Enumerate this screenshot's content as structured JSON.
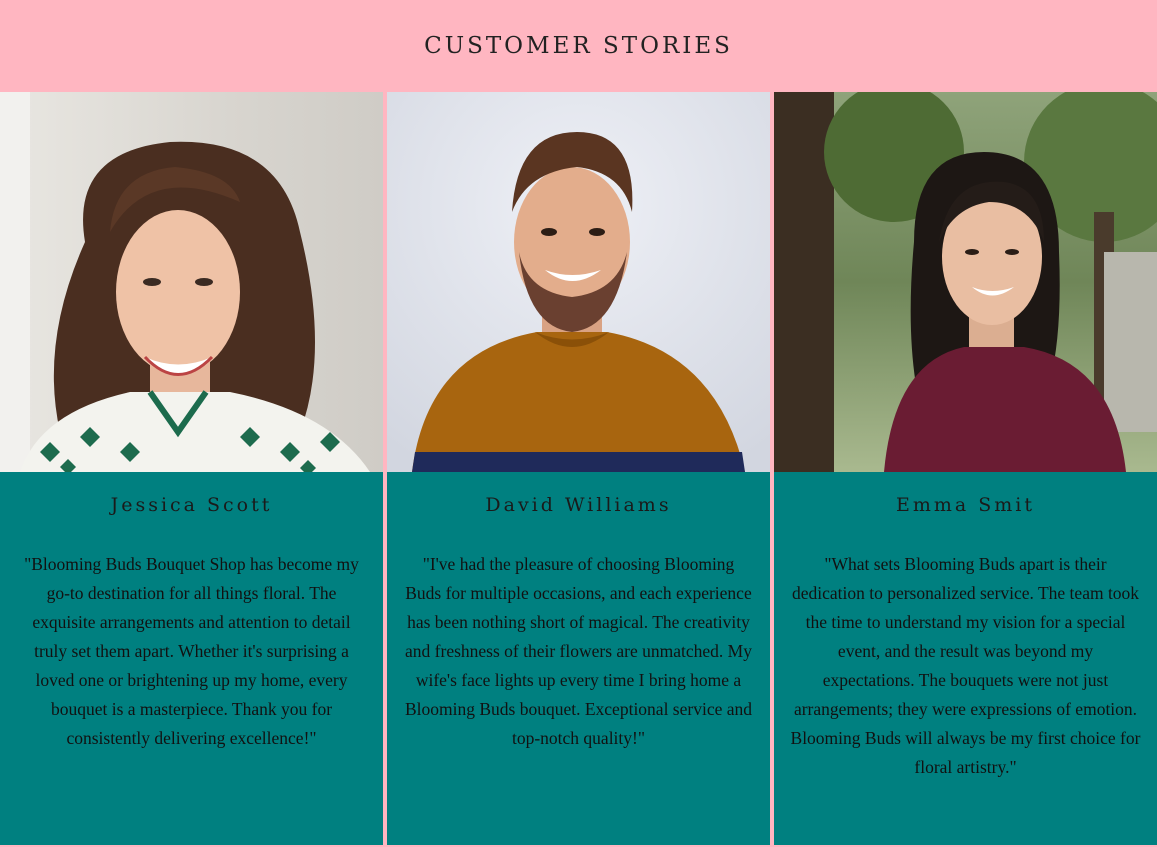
{
  "header": {
    "title": "CUSTOMER STORIES"
  },
  "cards": [
    {
      "name": "Jessica Scott",
      "quote": "\"Blooming Buds Bouquet Shop has become my go-to destination for all things floral. The exquisite arrangements and attention to detail truly set them apart. Whether it's surprising a loved one or brightening up my home, every bouquet is a masterpiece. Thank you for consistently delivering excellence!\"",
      "photo_icon": "woman-portrait-photo"
    },
    {
      "name": "David Williams",
      "quote": "\"I've had the pleasure of choosing Blooming Buds for multiple occasions, and each experience has been nothing short of magical. The creativity and freshness of their flowers are unmatched. My wife's face lights up every time I bring home a Blooming Buds bouquet. Exceptional service and top-notch quality!\"",
      "photo_icon": "man-portrait-photo"
    },
    {
      "name": "Emma Smit",
      "quote": "\"What sets Blooming Buds apart is their dedication to personalized service. The team took the time to understand my vision for a special event, and the result was beyond my expectations. The bouquets were not just arrangements; they were expressions of emotion. Blooming Buds will always be my first choice for floral artistry.\"",
      "photo_icon": "woman-outdoor-portrait-photo"
    }
  ],
  "colors": {
    "header_bg": "#ffb6c1",
    "card_bg": "#008080"
  }
}
